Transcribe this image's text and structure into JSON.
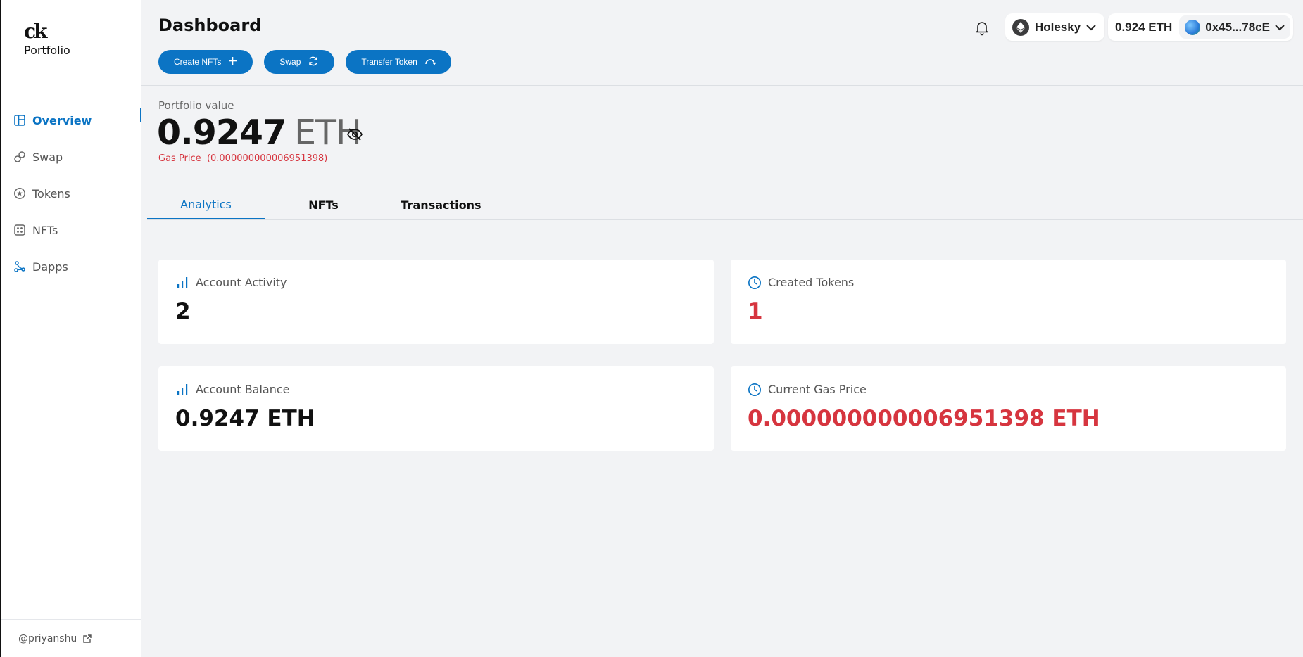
{
  "app": {
    "logo_mark": "ck",
    "logo_text": "Portfolio"
  },
  "sidebar": {
    "items": [
      {
        "label": "Overview",
        "icon": "overview-icon",
        "active": true
      },
      {
        "label": "Swap",
        "icon": "swap-link-icon",
        "active": false
      },
      {
        "label": "Tokens",
        "icon": "token-star-icon",
        "active": false
      },
      {
        "label": "NFTs",
        "icon": "nft-grid-icon",
        "active": false
      },
      {
        "label": "Dapps",
        "icon": "dapps-network-icon",
        "active": false
      }
    ],
    "footer_user": "@priyanshu"
  },
  "header": {
    "title": "Dashboard",
    "actions": [
      {
        "label": "Create NFTs",
        "icon": "plus-icon"
      },
      {
        "label": "Swap",
        "icon": "refresh-icon"
      },
      {
        "label": "Transfer Token",
        "icon": "transfer-arc-icon"
      }
    ],
    "network": "Holesky",
    "balance": "0.924 ETH",
    "address": "0x45...78cE"
  },
  "portfolio": {
    "label": "Portfolio value",
    "amount": "0.9247",
    "unit": "ETH",
    "gas_label": "Gas Price",
    "gas_value": "(0.000000000006951398)"
  },
  "tabs": [
    {
      "label": "Analytics",
      "active": true
    },
    {
      "label": "NFTs",
      "active": false
    },
    {
      "label": "Transactions",
      "active": false
    }
  ],
  "cards": [
    {
      "title": "Account Activity",
      "value": "2",
      "icon": "bar-chart-icon"
    },
    {
      "title": "Created Tokens",
      "value": "1",
      "icon": "clock-icon"
    },
    {
      "title": "Account Balance",
      "value": "0.9247 ETH",
      "icon": "bar-chart-icon"
    },
    {
      "title": "Current Gas Price",
      "value": "0.000000000006951398 ETH",
      "icon": "clock-icon"
    }
  ],
  "colors": {
    "accent": "#0b74c4",
    "danger": "#d6353f",
    "background": "#f2f3f5"
  }
}
